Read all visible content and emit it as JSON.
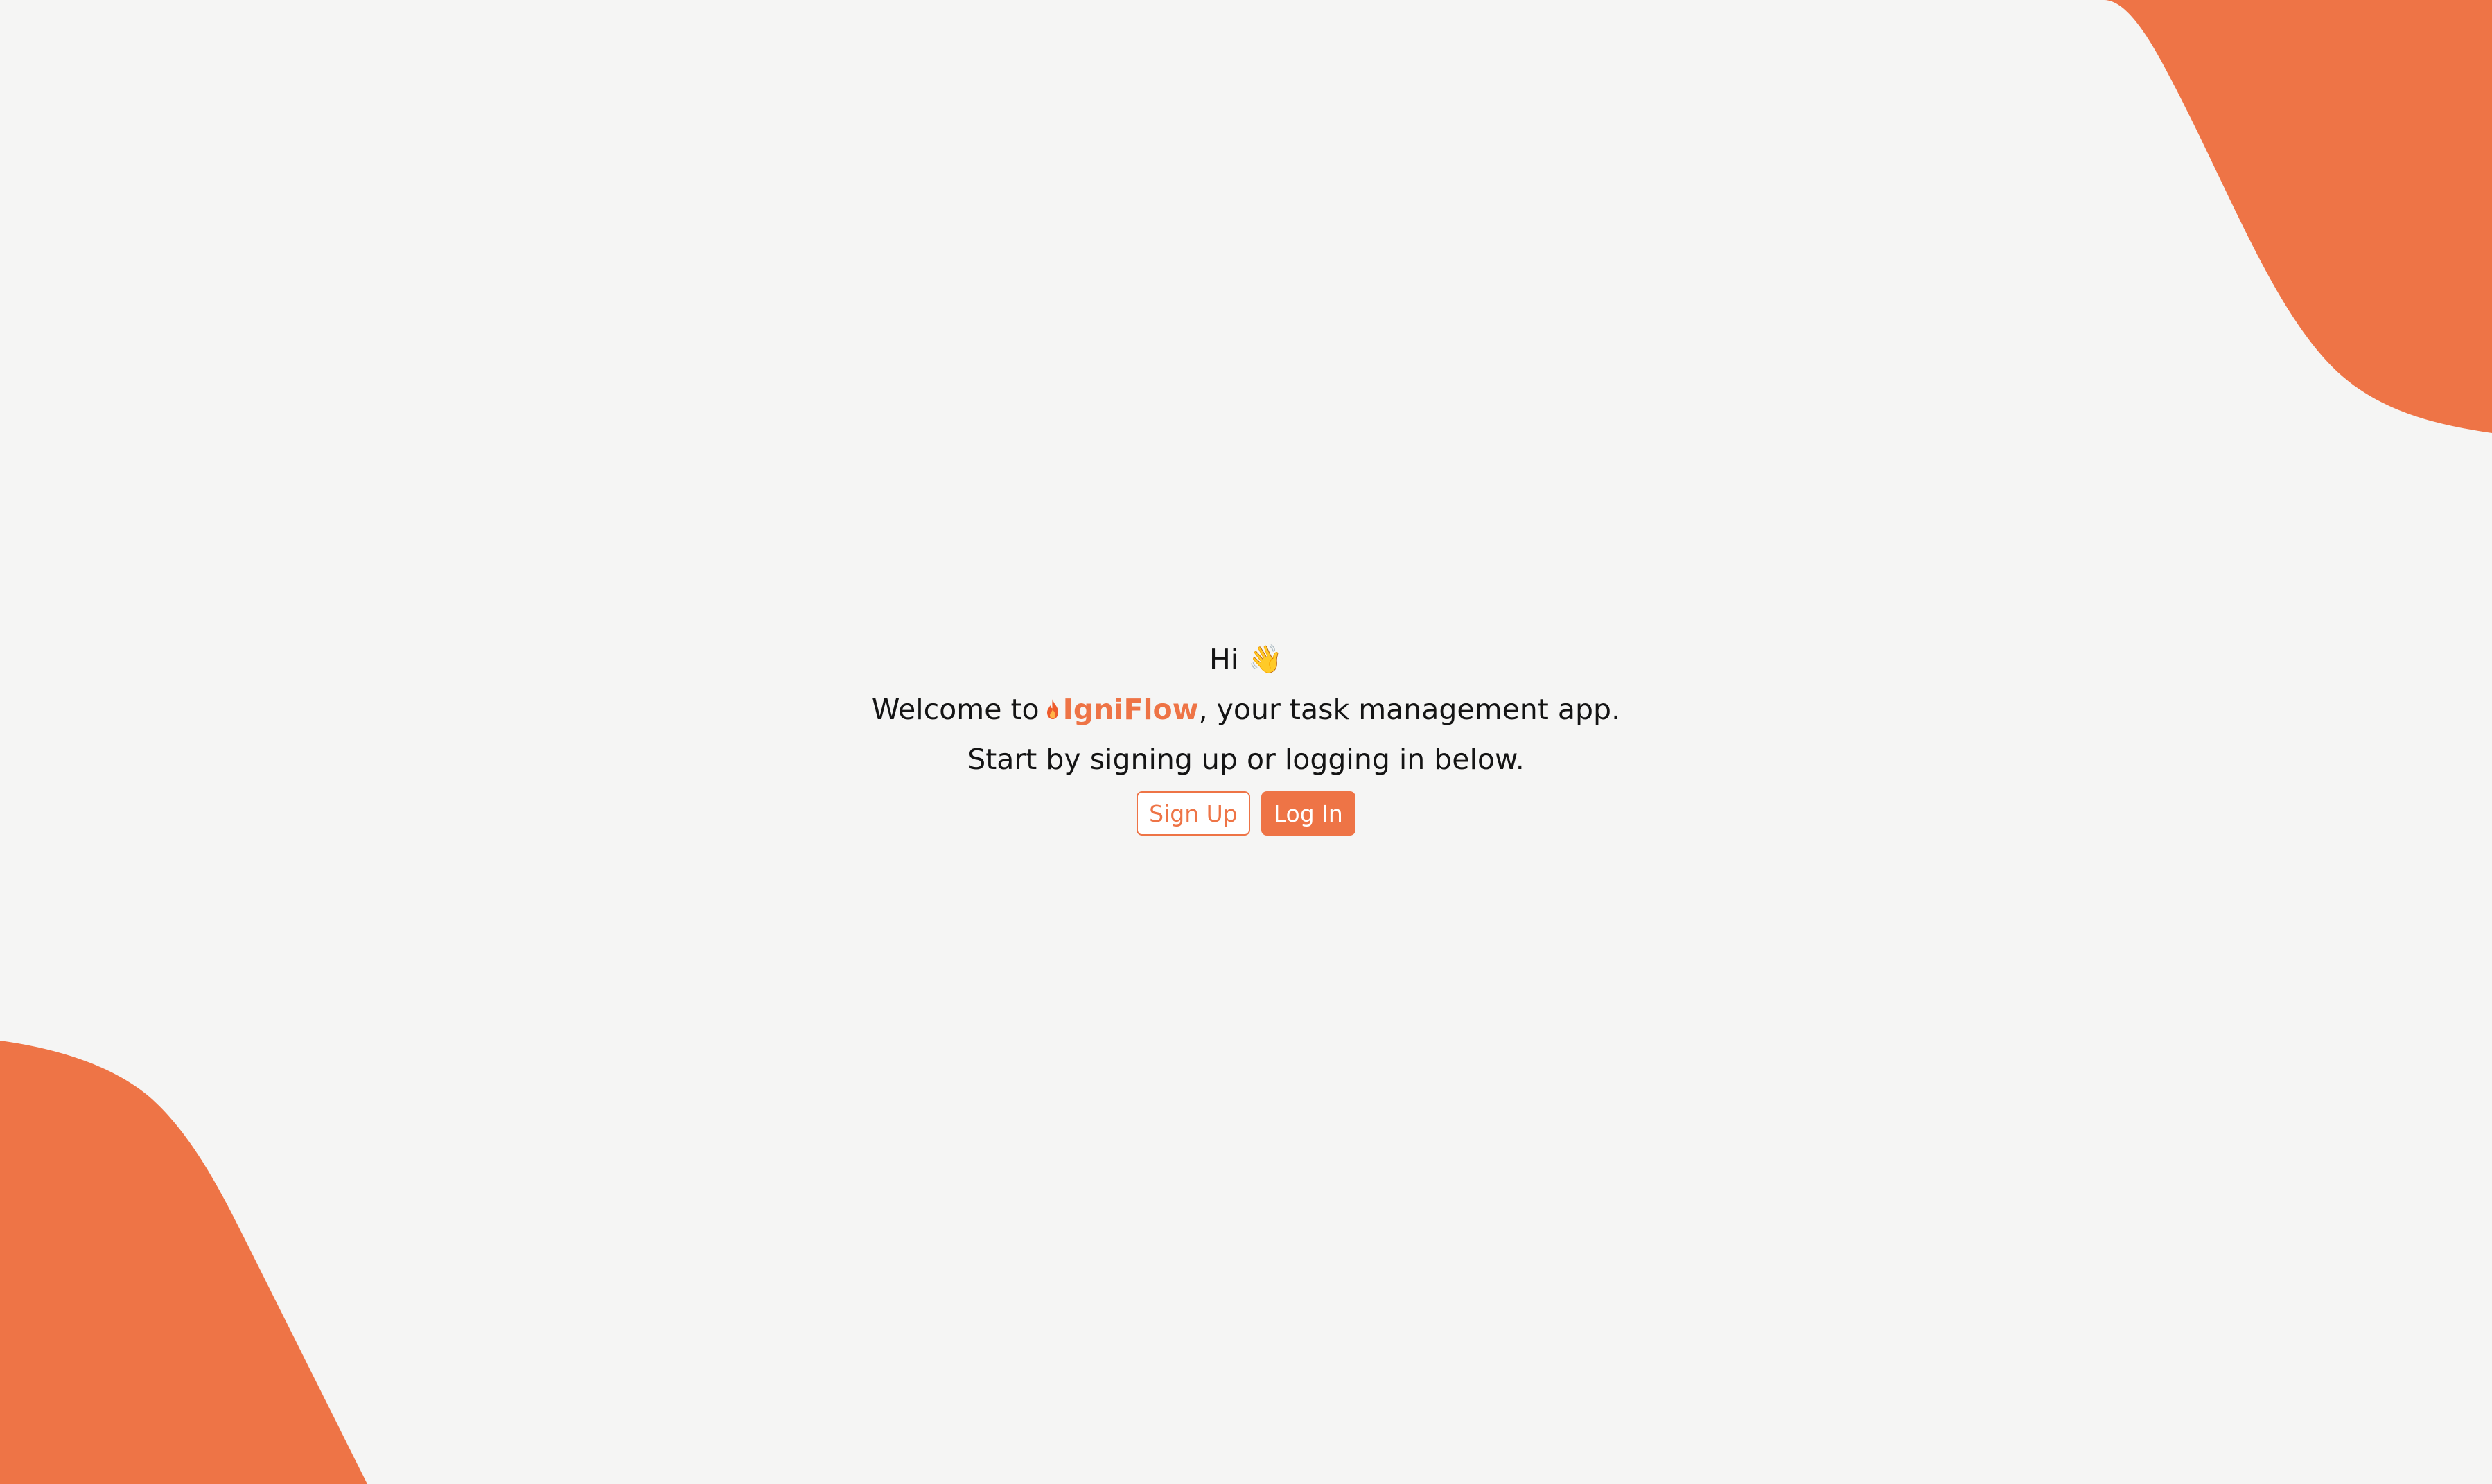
{
  "greeting": {
    "text": "Hi",
    "emoji": "👋"
  },
  "welcome": {
    "prefix": "Welcome to",
    "brand_name": "IgniFlow",
    "brand_icon": "flame-icon",
    "suffix": ", your task management app."
  },
  "instructions": "Start by signing up or logging in below.",
  "buttons": {
    "signup_label": "Sign Up",
    "login_label": "Log In"
  },
  "colors": {
    "accent": "#ee7446",
    "background": "#f5f5f4",
    "text": "#141414"
  }
}
